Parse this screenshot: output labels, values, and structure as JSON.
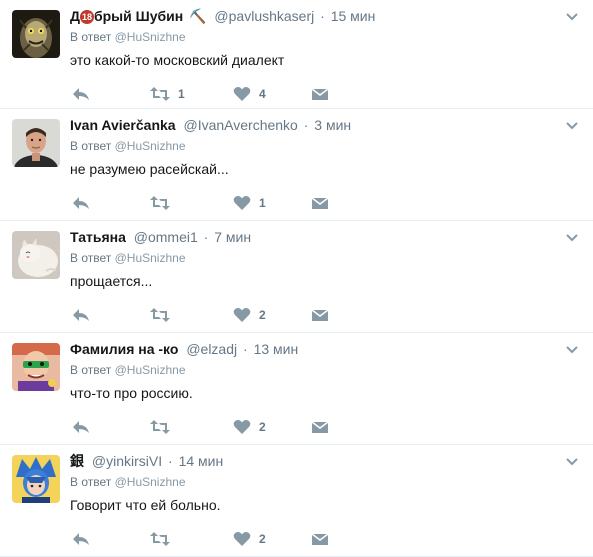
{
  "tweets": [
    {
      "name_pre": "Д",
      "name_badge": "18",
      "name_post": "брый Шубин",
      "emoji": "⛏️",
      "username": "@pavlushkaserj",
      "separator": "·",
      "time": "15 мин",
      "reply_label": "В ответ",
      "reply_to": "@HuSnizhne",
      "text": "это какой-то московский диалект",
      "retweets": "1",
      "likes": "4"
    },
    {
      "name": "Ivan Avierčanka",
      "username": "@IvanAverchenko",
      "separator": "·",
      "time": "3 мин",
      "reply_label": "В ответ",
      "reply_to": "@HuSnizhne",
      "text": "не разумею расейскай...",
      "retweets": "",
      "likes": "1"
    },
    {
      "name": "Татьяна",
      "username": "@ommei1",
      "separator": "·",
      "time": "7 мин",
      "reply_label": "В ответ",
      "reply_to": "@HuSnizhne",
      "text": "прощается...",
      "retweets": "",
      "likes": "2"
    },
    {
      "name": "Фамилия на -ко",
      "username": "@elzadj",
      "separator": "·",
      "time": "13 мин",
      "reply_label": "В ответ",
      "reply_to": "@HuSnizhne",
      "text": "что-то про россию.",
      "retweets": "",
      "likes": "2"
    },
    {
      "name": "銀",
      "username": "@yinkirsiVI",
      "separator": "·",
      "time": "14 мин",
      "reply_label": "В ответ",
      "reply_to": "@HuSnizhne",
      "text": "Говорит что ей больно.",
      "retweets": "",
      "likes": "2"
    }
  ],
  "colors": {
    "text": "#14171a",
    "muted": "#657786",
    "icon": "#8899a6",
    "border": "#e6ecf0"
  },
  "icons": [
    "reply-icon",
    "retweet-icon",
    "like-icon",
    "direct-message-icon",
    "more-caret-icon"
  ]
}
